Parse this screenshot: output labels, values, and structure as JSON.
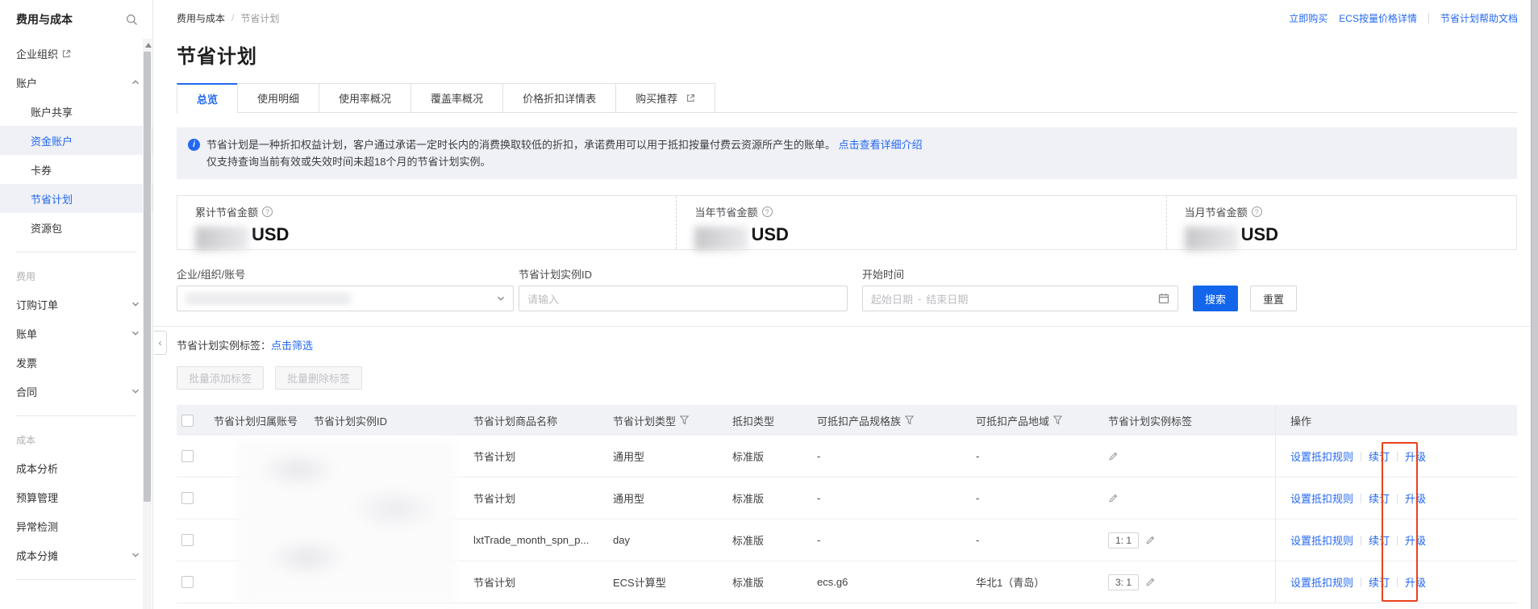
{
  "colors": {
    "accent": "#2468f2",
    "search_button": "#1366ec",
    "annotation_red": "#e8421d",
    "banner_bg": "#eff1f6",
    "table_header_bg": "#f0f2f5"
  },
  "sidebar": {
    "title": "费用与成本",
    "items": [
      {
        "label": "企业组织"
      },
      {
        "label": "账户"
      },
      {
        "label": "账户共享"
      },
      {
        "label": "资金账户"
      },
      {
        "label": "卡券"
      },
      {
        "label": "节省计划"
      },
      {
        "label": "资源包"
      },
      {
        "label": "费用"
      },
      {
        "label": "订购订单"
      },
      {
        "label": "账单"
      },
      {
        "label": "发票"
      },
      {
        "label": "合同"
      },
      {
        "label": "成本"
      },
      {
        "label": "成本分析"
      },
      {
        "label": "预算管理"
      },
      {
        "label": "异常检测"
      },
      {
        "label": "成本分摊"
      }
    ]
  },
  "topbar": {
    "breadcrumb": {
      "parent": "费用与成本",
      "sep": "/",
      "current": "节省计划"
    },
    "links": [
      "立即购买",
      "ECS按量价格详情",
      "节省计划帮助文档"
    ]
  },
  "page": {
    "title": "节省计划"
  },
  "tabs": [
    {
      "label": "总览"
    },
    {
      "label": "使用明细"
    },
    {
      "label": "使用率概况"
    },
    {
      "label": "覆盖率概况"
    },
    {
      "label": "价格折扣详情表"
    },
    {
      "label": "购买推荐"
    }
  ],
  "banner": {
    "line1": "节省计划是一种折扣权益计划，客户通过承诺一定时长内的消费换取较低的折扣，承诺费用可以用于抵扣按量付费云资源所产生的账单。",
    "link": "点击查看详细介绍",
    "line2": "仅支持查询当前有效或失效时间未超18个月的节省计划实例。"
  },
  "stats": [
    {
      "label": "累计节省金额",
      "unit": "USD"
    },
    {
      "label": "当年节省金额",
      "unit": "USD"
    },
    {
      "label": "当月节省金额",
      "unit": "USD"
    }
  ],
  "filters": {
    "account_label": "企业/组织/账号",
    "instance_label": "节省计划实例ID",
    "instance_placeholder": "请输入",
    "time_label": "开始时间",
    "start_placeholder": "起始日期",
    "range_sep": "-",
    "end_placeholder": "结束日期",
    "search_label": "搜索",
    "reset_label": "重置"
  },
  "tag_filter": {
    "label": "节省计划实例标签：",
    "link": "点击筛选"
  },
  "batch_buttons": {
    "add": "批量添加标签",
    "remove": "批量删除标签"
  },
  "table": {
    "columns": [
      "节省计划归属账号",
      "节省计划实例ID",
      "节省计划商品名称",
      "节省计划类型",
      "抵扣类型",
      "可抵扣产品规格族",
      "可抵扣产品地域",
      "节省计划实例标签",
      "操作"
    ],
    "actions": [
      "设置抵扣规则",
      "续订",
      "升级"
    ],
    "rows": [
      {
        "product": "节省计划",
        "type": "通用型",
        "deduct": "标准版",
        "spec": "-",
        "region": "-",
        "tag": ""
      },
      {
        "product": "节省计划",
        "type": "通用型",
        "deduct": "标准版",
        "spec": "-",
        "region": "-",
        "tag": ""
      },
      {
        "product": "lxtTrade_month_spn_p...",
        "type": "day",
        "deduct": "标准版",
        "spec": "-",
        "region": "-",
        "tag": "1: 1"
      },
      {
        "product": "节省计划",
        "type": "ECS计算型",
        "deduct": "标准版",
        "spec": "ecs.g6",
        "region": "华北1（青岛）",
        "tag": "3: 1"
      }
    ]
  }
}
